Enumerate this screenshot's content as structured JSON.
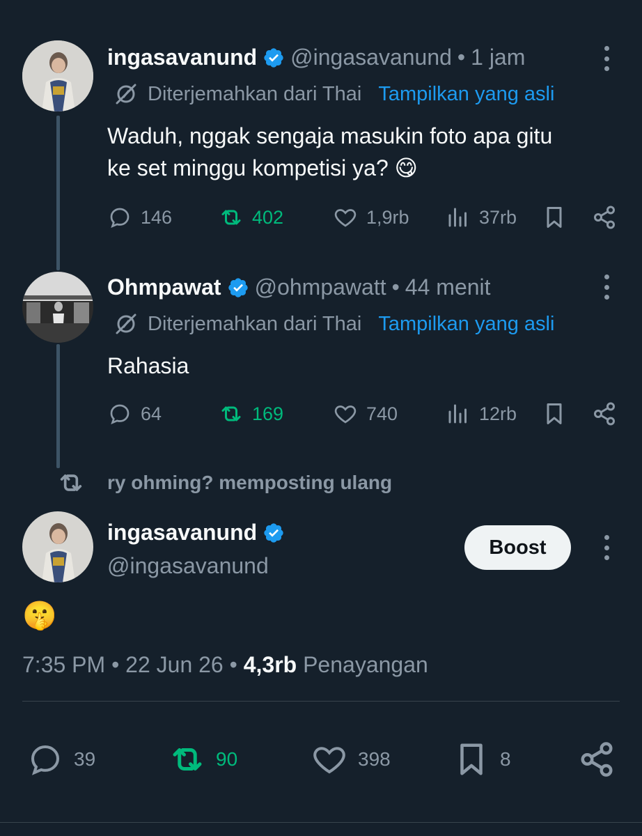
{
  "colors": {
    "background": "#15202b",
    "link": "#1d9bf0",
    "muted": "#8b98a5",
    "repost_green": "#00ba7c",
    "verified_blue": "#1d9bf0"
  },
  "tweet1": {
    "display_name": "ingasavanund",
    "handle": "@ingasavanund",
    "separator": "•",
    "time": "1 jam",
    "translated_label": "Diterjemahkan dari Thai",
    "show_original": "Tampilkan yang asli",
    "text_line1": "Waduh, nggak sengaja masukin foto apa gitu",
    "text_line2": "ke set minggu kompetisi ya? 😋",
    "replies": "146",
    "reposts": "402",
    "likes": "1,9rb",
    "views": "37rb"
  },
  "tweet2": {
    "display_name": "Ohmpawat",
    "handle": "@ohmpawatt",
    "separator": "•",
    "time": "44 menit",
    "translated_label": "Diterjemahkan dari Thai",
    "show_original": "Tampilkan yang asli",
    "text": "Rahasia",
    "replies": "64",
    "reposts": "169",
    "likes": "740",
    "views": "12rb"
  },
  "repost_context": {
    "text": "ry ohming? memposting ulang"
  },
  "main_tweet": {
    "display_name": "ingasavanund",
    "handle": "@ingasavanund",
    "boost_label": "Boost",
    "text": "🤫",
    "time": "7:35 PM",
    "separator": "•",
    "date": "22 Jun 26",
    "views_count": "4,3rb",
    "views_label": "Penayangan",
    "replies": "39",
    "reposts": "90",
    "likes": "398",
    "bookmarks": "8"
  }
}
